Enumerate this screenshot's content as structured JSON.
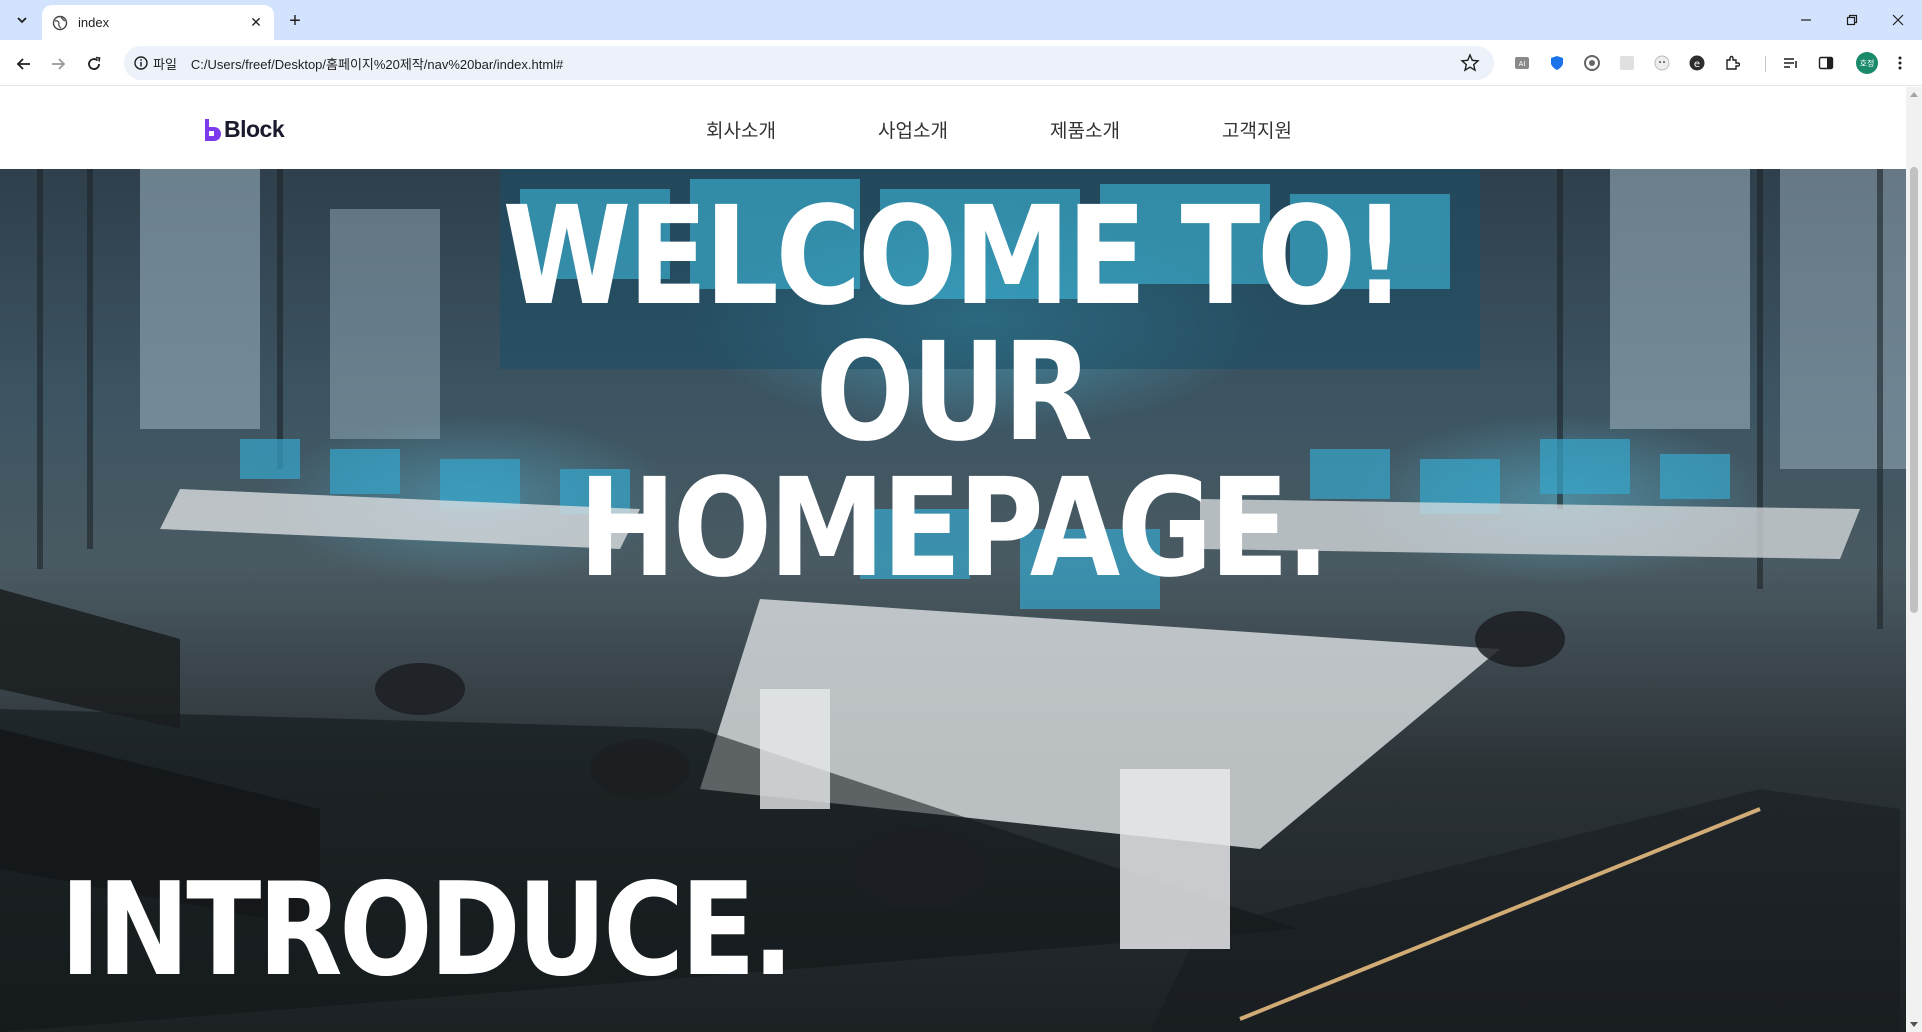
{
  "browser": {
    "tab_title": "index",
    "url_chip_label": "파일",
    "url": "C:/Users/freef/Desktop/홈페이지%20제작/nav%20bar/index.html#",
    "avatar_initials": "호정"
  },
  "site": {
    "logo_text": "Block",
    "brand_color": "#7c3aed",
    "nav": [
      {
        "label": "회사소개"
      },
      {
        "label": "사업소개"
      },
      {
        "label": "제품소개"
      },
      {
        "label": "고객지원"
      }
    ],
    "hero": {
      "headline_lines": [
        "WELCOME TO!",
        "OUR",
        "HOMEPAGE."
      ],
      "introduce": "INTRODUCE.",
      "background": "office-interior-image"
    }
  }
}
